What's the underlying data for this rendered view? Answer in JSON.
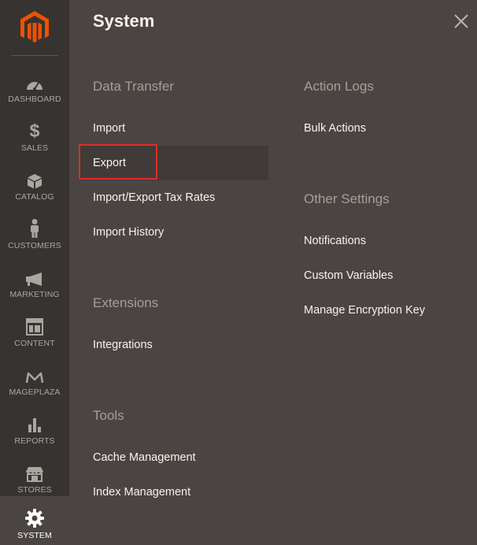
{
  "sidebar": {
    "items": [
      {
        "label": "DASHBOARD",
        "icon": "dashboard-icon"
      },
      {
        "label": "SALES",
        "icon": "dollar-icon"
      },
      {
        "label": "CATALOG",
        "icon": "box-icon"
      },
      {
        "label": "CUSTOMERS",
        "icon": "person-icon"
      },
      {
        "label": "MARKETING",
        "icon": "megaphone-icon"
      },
      {
        "label": "CONTENT",
        "icon": "layout-icon"
      },
      {
        "label": "MAGEPLAZA",
        "icon": "mageplaza-icon"
      },
      {
        "label": "REPORTS",
        "icon": "bar-chart-icon"
      },
      {
        "label": "STORES",
        "icon": "store-icon"
      },
      {
        "label": "SYSTEM",
        "icon": "gear-icon",
        "active": true
      }
    ]
  },
  "panel": {
    "title": "System",
    "sections": {
      "data_transfer": {
        "title": "Data Transfer",
        "links": [
          "Import",
          "Export",
          "Import/Export Tax Rates",
          "Import History"
        ]
      },
      "extensions": {
        "title": "Extensions",
        "links": [
          "Integrations"
        ]
      },
      "tools": {
        "title": "Tools",
        "links": [
          "Cache Management",
          "Index Management"
        ]
      },
      "action_logs": {
        "title": "Action Logs",
        "links": [
          "Bulk Actions"
        ]
      },
      "other_settings": {
        "title": "Other Settings",
        "links": [
          "Notifications",
          "Custom Variables",
          "Manage Encryption Key"
        ]
      }
    }
  },
  "colors": {
    "sidebar_bg": "#373330",
    "panel_bg": "#4a4542",
    "brand_orange": "#eb5202",
    "highlight_red": "#e02b27"
  }
}
